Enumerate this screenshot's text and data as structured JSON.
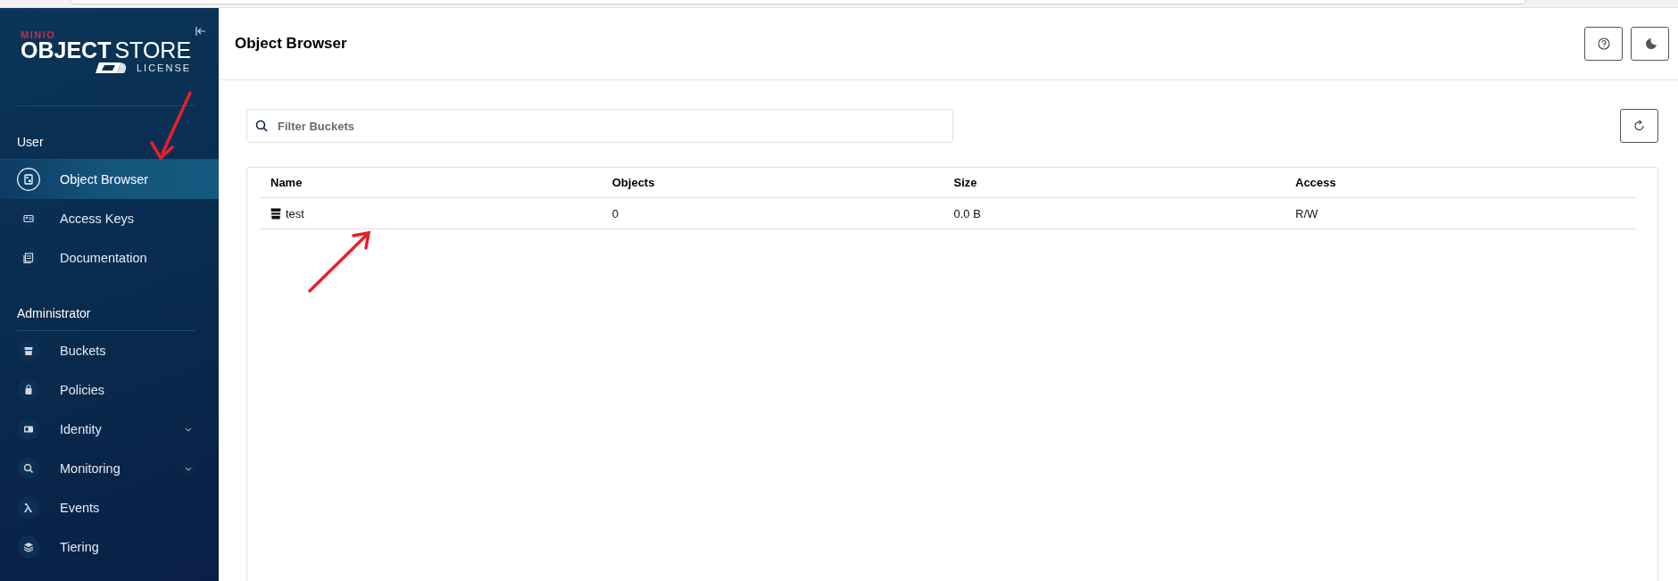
{
  "sidebar": {
    "logo": {
      "brand": "MINIO",
      "product_bold": "OBJECT",
      "product_light": "STORE",
      "license": "LICENSE"
    },
    "sections": [
      {
        "title": "User",
        "items": [
          {
            "label": "Object Browser",
            "selected": true,
            "has_submenu": false
          },
          {
            "label": "Access Keys",
            "selected": false,
            "has_submenu": false
          },
          {
            "label": "Documentation",
            "selected": false,
            "has_submenu": false
          }
        ]
      },
      {
        "title": "Administrator",
        "items": [
          {
            "label": "Buckets",
            "selected": false,
            "has_submenu": false
          },
          {
            "label": "Policies",
            "selected": false,
            "has_submenu": false
          },
          {
            "label": "Identity",
            "selected": false,
            "has_submenu": true
          },
          {
            "label": "Monitoring",
            "selected": false,
            "has_submenu": true
          },
          {
            "label": "Events",
            "selected": false,
            "has_submenu": false
          },
          {
            "label": "Tiering",
            "selected": false,
            "has_submenu": false
          }
        ]
      }
    ]
  },
  "header": {
    "title": "Object Browser"
  },
  "search": {
    "placeholder": "Filter Buckets"
  },
  "table": {
    "columns": [
      "Name",
      "Objects",
      "Size",
      "Access"
    ],
    "rows": [
      {
        "cells": [
          "test",
          "0",
          "0.0 B",
          "R/W"
        ]
      }
    ]
  }
}
